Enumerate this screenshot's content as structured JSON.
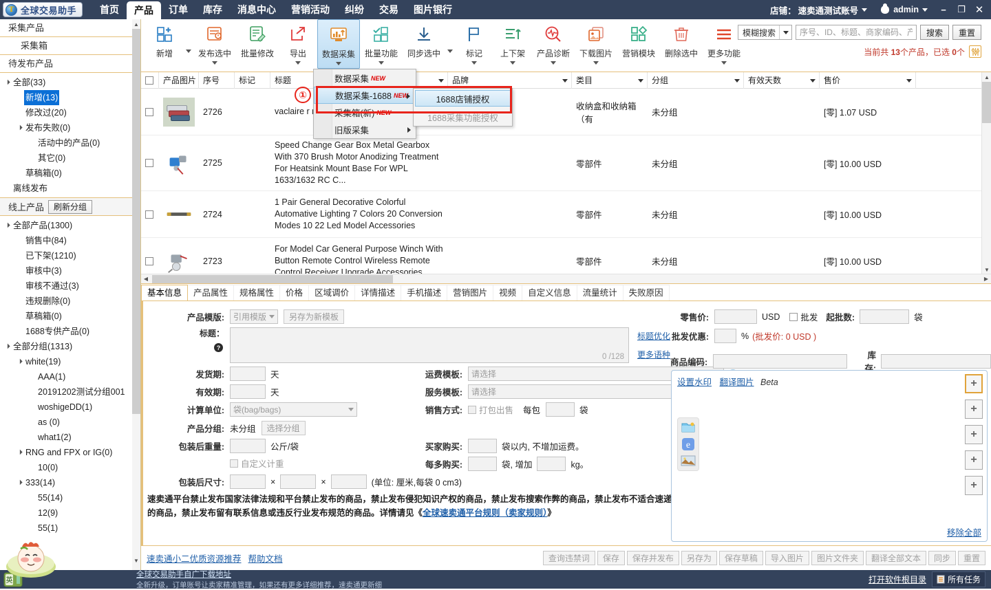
{
  "titlebar": {
    "logo_text": "全球交易助手",
    "nav": [
      {
        "label": "首页",
        "active": false
      },
      {
        "label": "产品",
        "active": true
      },
      {
        "label": "订单",
        "active": false
      },
      {
        "label": "库存",
        "active": false
      },
      {
        "label": "消息中心",
        "active": false
      },
      {
        "label": "营销活动",
        "active": false
      },
      {
        "label": "纠纷",
        "active": false
      },
      {
        "label": "交易",
        "active": false
      },
      {
        "label": "图片银行",
        "active": false
      }
    ],
    "shop_label": "店铺：",
    "shop_name": "速卖通测试账号",
    "user_name": "admin",
    "minimize": "−",
    "maximize": "❐",
    "close": "✕"
  },
  "toolbar": {
    "tools": [
      {
        "label": "新增",
        "icon": "add-grid-icon",
        "caret": false,
        "sep_caret": true,
        "selected": false
      },
      {
        "label": "发布选中",
        "icon": "publish-icon",
        "caret": true,
        "selected": false
      },
      {
        "label": "批量修改",
        "icon": "batch-edit-icon",
        "caret": false,
        "selected": false
      },
      {
        "label": "导出",
        "icon": "export-icon",
        "caret": true,
        "selected": false
      },
      {
        "label": "数据采集",
        "icon": "data-collect-icon",
        "caret": true,
        "selected": true
      },
      {
        "label": "批量功能",
        "icon": "batch-func-icon",
        "caret": true,
        "selected": false
      },
      {
        "label": "同步选中",
        "icon": "sync-icon",
        "caret": false,
        "sep_caret": true,
        "selected": false
      },
      {
        "label": "标记",
        "icon": "flag-icon",
        "caret": true,
        "selected": false
      },
      {
        "label": "上下架",
        "icon": "shelf-icon",
        "caret": true,
        "selected": false
      },
      {
        "label": "产品诊断",
        "icon": "diagnose-icon",
        "caret": true,
        "selected": false
      },
      {
        "label": "下载图片",
        "icon": "download-image-icon",
        "caret": true,
        "selected": false
      },
      {
        "label": "营销模块",
        "icon": "marketing-icon",
        "caret": false,
        "selected": false
      },
      {
        "label": "删除选中",
        "icon": "trash-icon",
        "caret": false,
        "selected": false
      },
      {
        "label": "更多功能",
        "icon": "more-icon",
        "caret": true,
        "selected": false
      }
    ],
    "search_mode": "模糊搜索",
    "search_placeholder": "序号、ID、标题、商家编码、产...",
    "search_value": "",
    "search_button": "搜索",
    "reset_button": "重置",
    "count_prefix": "当前共 ",
    "count_total": "13",
    "count_mid": "个产品，已选 ",
    "count_selected": "0",
    "count_suffix": "个"
  },
  "menu": {
    "items": [
      {
        "label": "数据采集",
        "new": "NEW",
        "highlight": false,
        "submenu": false
      },
      {
        "label": "数据采集-1688",
        "new": "NEW",
        "highlight": true,
        "submenu": true
      },
      {
        "label": "采集箱(新)",
        "new": "NEW",
        "highlight": false,
        "submenu": false
      },
      {
        "label": "旧版采集",
        "new": "",
        "highlight": false,
        "submenu": true
      }
    ],
    "submenu_items": [
      {
        "label": "1688店铺授权",
        "highlight": true,
        "disabled": false
      },
      {
        "label": "1688采集功能授权",
        "highlight": false,
        "disabled": true
      }
    ],
    "marker": "①"
  },
  "sidebar": {
    "section1_title": "采集产品",
    "section1_sub": "采集箱",
    "section2_title": "待发布产品",
    "tree1": [
      {
        "label": "全部(33)",
        "indent": 0,
        "arrow": "▲",
        "selected": false
      },
      {
        "label": "新增(13)",
        "indent": 1,
        "arrow": "",
        "selected": true
      },
      {
        "label": "修改过(20)",
        "indent": 1,
        "arrow": "",
        "selected": false
      },
      {
        "label": "发布失败(0)",
        "indent": 1,
        "arrow": "▲",
        "selected": false
      },
      {
        "label": "活动中的产品(0)",
        "indent": 2,
        "arrow": "",
        "selected": false
      },
      {
        "label": "其它(0)",
        "indent": 2,
        "arrow": "",
        "selected": false
      },
      {
        "label": "草稿箱(0)",
        "indent": 1,
        "arrow": "",
        "selected": false
      },
      {
        "label": "离线发布",
        "indent": 0,
        "arrow": "",
        "selected": false
      }
    ],
    "bar_label": "线上产品",
    "bar_button": "刷新分组",
    "tree2": [
      {
        "label": "全部产品(1300)",
        "indent": 0,
        "arrow": "▲",
        "selected": false
      },
      {
        "label": "销售中(84)",
        "indent": 1,
        "arrow": "",
        "selected": false
      },
      {
        "label": "已下架(1210)",
        "indent": 1,
        "arrow": "",
        "selected": false
      },
      {
        "label": "审核中(3)",
        "indent": 1,
        "arrow": "",
        "selected": false
      },
      {
        "label": "审核不通过(3)",
        "indent": 1,
        "arrow": "",
        "selected": false
      },
      {
        "label": "违规删除(0)",
        "indent": 1,
        "arrow": "",
        "selected": false
      },
      {
        "label": "草稿箱(0)",
        "indent": 1,
        "arrow": "",
        "selected": false
      },
      {
        "label": "1688专供产品(0)",
        "indent": 1,
        "arrow": "",
        "selected": false
      },
      {
        "label": "全部分组(1313)",
        "indent": 0,
        "arrow": "▲",
        "selected": false
      },
      {
        "label": "white(19)",
        "indent": 1,
        "arrow": "▲",
        "selected": false
      },
      {
        "label": "AAA(1)",
        "indent": 2,
        "arrow": "",
        "selected": false
      },
      {
        "label": "20191202测试分组001",
        "indent": 2,
        "arrow": "",
        "selected": false
      },
      {
        "label": "woshigeDD(1)",
        "indent": 2,
        "arrow": "",
        "selected": false
      },
      {
        "label": "as (0)",
        "indent": 2,
        "arrow": "",
        "selected": false
      },
      {
        "label": "what1(2)",
        "indent": 2,
        "arrow": "",
        "selected": false
      },
      {
        "label": "RNG and FPX or IG(0)",
        "indent": 1,
        "arrow": "▲",
        "selected": false
      },
      {
        "label": "10(0)",
        "indent": 2,
        "arrow": "",
        "selected": false
      },
      {
        "label": "333(14)",
        "indent": 1,
        "arrow": "▲",
        "selected": false
      },
      {
        "label": "55(14)",
        "indent": 2,
        "arrow": "",
        "selected": false
      },
      {
        "label": "12(9)",
        "indent": 2,
        "arrow": "",
        "selected": false
      },
      {
        "label": "55(1)",
        "indent": 2,
        "arrow": "",
        "selected": false
      }
    ]
  },
  "table": {
    "headers": [
      "产品图片",
      "序号",
      "标记",
      "标题",
      "品牌",
      "类目",
      "分组",
      "有效天数",
      "售价"
    ],
    "rows": [
      {
        "seq": "2726",
        "mark": "",
        "title": "vaclaire\nr\nr ind...",
        "brand": "",
        "category": "收纳盒和收纳箱（有",
        "group": "未分组",
        "days": "",
        "price": "[零] 1.07 USD"
      },
      {
        "seq": "2725",
        "mark": "",
        "title": "Speed Change Gear Box Metal Gearbox With 370 Brush Motor Anodizing Treatment For Heatsink Mount Base For WPL 1633/1632 RC C...",
        "brand": "",
        "category": "零部件",
        "group": "未分组",
        "days": "",
        "price": "[零] 10.00 USD"
      },
      {
        "seq": "2724",
        "mark": "",
        "title": "1 Pair General Decorative Colorful Automative Lighting 7 Colors 20 Conversion Modes 10 22 Led Model Accessories",
        "brand": "",
        "category": "零部件",
        "group": "未分组",
        "days": "",
        "price": "[零] 10.00 USD"
      },
      {
        "seq": "2723",
        "mark": "",
        "title": "For Model Car General Purpose Winch With Button Remote Control Wireless Remote Control Receiver Upgrade Accessories",
        "brand": "",
        "category": "零部件",
        "group": "未分组",
        "days": "",
        "price": "[零] 10.00 USD"
      }
    ]
  },
  "tabs": [
    {
      "label": "基本信息",
      "active": true
    },
    {
      "label": "产品属性",
      "active": false
    },
    {
      "label": "规格属性",
      "active": false
    },
    {
      "label": "价格",
      "active": false
    },
    {
      "label": "区域调价",
      "active": false
    },
    {
      "label": "详情描述",
      "active": false
    },
    {
      "label": "手机描述",
      "active": false
    },
    {
      "label": "营销图片",
      "active": false
    },
    {
      "label": "视频",
      "active": false
    },
    {
      "label": "自定义信息",
      "active": false
    },
    {
      "label": "流量统计",
      "active": false
    },
    {
      "label": "失败原因",
      "active": false
    }
  ],
  "form": {
    "template_label": "产品模版:",
    "template_select": "引用模版",
    "template_saveas": "另存为新模板",
    "title_label": "标题：",
    "title_value": "",
    "title_counter": "0 /128",
    "title_optimize": "标题优化",
    "more_lang": "更多语种",
    "ship_label": "发货期:",
    "ship_value": "",
    "ship_unit": "天",
    "valid_label": "有效期:",
    "valid_value": "",
    "valid_unit": "天",
    "unit_label": "计算单位:",
    "unit_value": "袋(bag/bags)",
    "group_label": "产品分组:",
    "group_value": "未分组",
    "group_button": "选择分组",
    "weight_label": "包装后重量:",
    "weight_value": "",
    "weight_unit": "公斤/袋",
    "custom_weigh": "自定义计重",
    "size_label": "包装后尺寸:",
    "size_x": "",
    "size_y": "",
    "size_z": "",
    "size_note": "(单位: 厘米,每袋  0 cm3)",
    "freight_label": "运费模板:",
    "freight_value": "请选择",
    "service_label": "服务模板:",
    "service_value": "请选择",
    "sale_label": "销售方式:",
    "sale_pack": "打包出售",
    "sale_each": "每包",
    "sale_each_value": "",
    "sale_each_unit": "袋",
    "buyer_label": "买家购买:",
    "buyer_value": "",
    "buyer_note": "袋以内, 不增加运费。",
    "buyer_more_label": "每多购买:",
    "buyer_more_value": "",
    "buyer_more_mid": "袋, 增加",
    "buyer_more_kg": "",
    "buyer_more_unit": "kg。",
    "retail_label": "零售价:",
    "retail_value": "",
    "retail_currency": "USD",
    "wholesale_chk": "批发",
    "minorder_label": "起批数:",
    "minorder_value": "",
    "minorder_unit": "袋",
    "discount_label": "批发优惠:",
    "discount_value": "",
    "discount_pct": "%",
    "discount_note": "(批发价: 0 USD )",
    "sku_label": "商品编码:",
    "sku_value": "",
    "stock_label": "库存:",
    "stock_value": "",
    "watermark_link": "设置水印",
    "translate_link": "翻译图片",
    "beta": "Beta",
    "remove_all": "移除全部",
    "notice": "速卖通平台禁止发布国家法律法规和平台禁止发布的商品，禁止发布侵犯知识产权的商品，禁止发布搜索作弊的商品，禁止发布不适合速递的商品，禁止发布留有联系信息或违反行业发布规范的商品。详情请见《",
    "notice_link": "全球速卖通平台规则（卖家规则）",
    "notice_end": "》"
  },
  "bottombar": {
    "link1": "速卖通小二优质资源推荐",
    "link2": "帮助文档",
    "buttons": [
      "查询违禁词",
      "保存",
      "保存并发布",
      "另存为",
      "保存草稿",
      "导入图片",
      "图片文件夹",
      "翻译全部文本",
      "同步",
      "重置"
    ]
  },
  "statusbar": {
    "marquee_title": "全球交易助手自广下载地址",
    "marquee_sub": "全新升级，订单账号让卖家精准管理，如果还有更多详细推荐，速卖通更新细",
    "open_dir": "打开软件根目录",
    "all_tasks": "所有任务",
    "badge": "英"
  }
}
